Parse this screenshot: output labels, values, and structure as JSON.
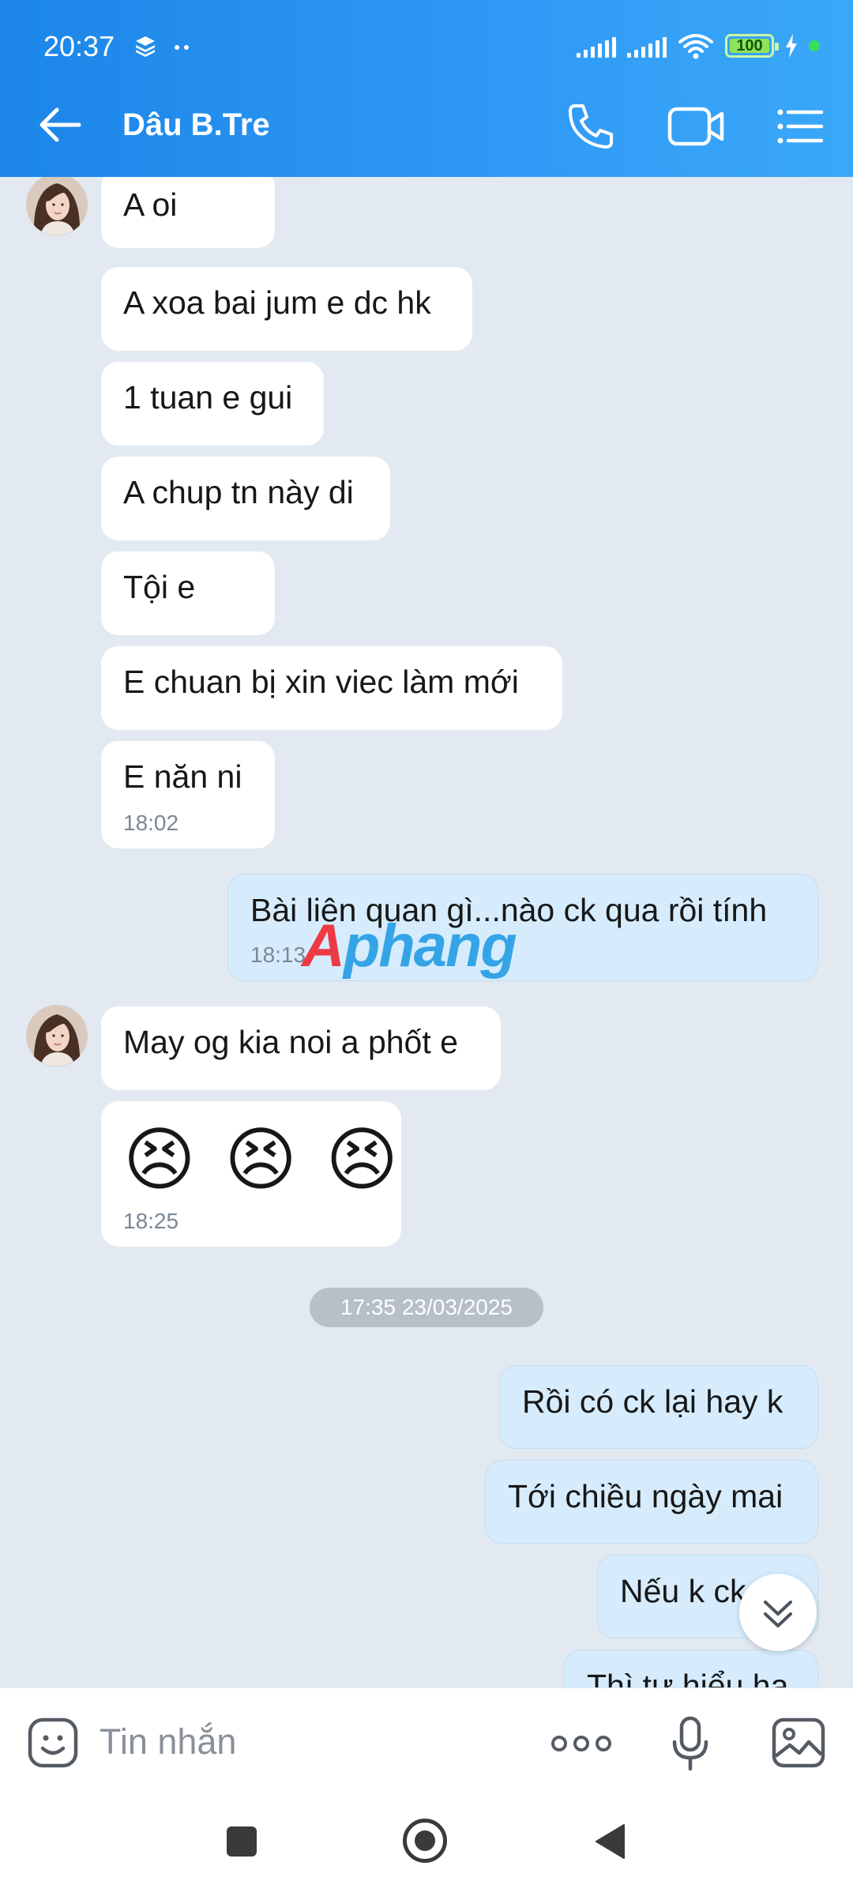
{
  "status_bar": {
    "time": "20:37",
    "battery": "100",
    "icons": [
      "layers-icon",
      "dots-icon",
      "signal-icon",
      "signal-icon",
      "wifi-icon",
      "battery-icon",
      "charging-icon"
    ]
  },
  "header": {
    "title": "Dâu B.Tre",
    "icons": [
      "back-arrow-icon",
      "phone-icon",
      "video-camera-icon",
      "menu-list-icon"
    ]
  },
  "messages": [
    {
      "side": "left",
      "text": "A oi"
    },
    {
      "side": "left",
      "text": "A xoa bai jum e dc hk"
    },
    {
      "side": "left",
      "text": "1 tuan e gui"
    },
    {
      "side": "left",
      "text": "A chup tn này di"
    },
    {
      "side": "left",
      "text": "Tội e"
    },
    {
      "side": "left",
      "text": "E chuan bị xin viec làm mới"
    },
    {
      "side": "left",
      "text": "E năn ni",
      "time": "18:02"
    },
    {
      "side": "right",
      "text": "Bài liên quan gì...nào ck qua rồi tính",
      "time": "18:13"
    },
    {
      "side": "left",
      "text": "May og kia noi a phốt e"
    },
    {
      "side": "left",
      "text": "😣 😣 😣",
      "time": "18:25"
    },
    {
      "side": "right",
      "text": "Rồi có ck lại hay k"
    },
    {
      "side": "right",
      "text": "Tới chiều ngày mai"
    },
    {
      "side": "right",
      "text": "Nếu k ck"
    },
    {
      "side": "right",
      "text": "Thì tự hiểu ha"
    }
  ],
  "date_separator": "17:35 23/03/2025",
  "watermark": {
    "part1": "A",
    "part2": "phang"
  },
  "input": {
    "placeholder": "Tin nhắn",
    "value": ""
  },
  "accent": "#1e88e5"
}
